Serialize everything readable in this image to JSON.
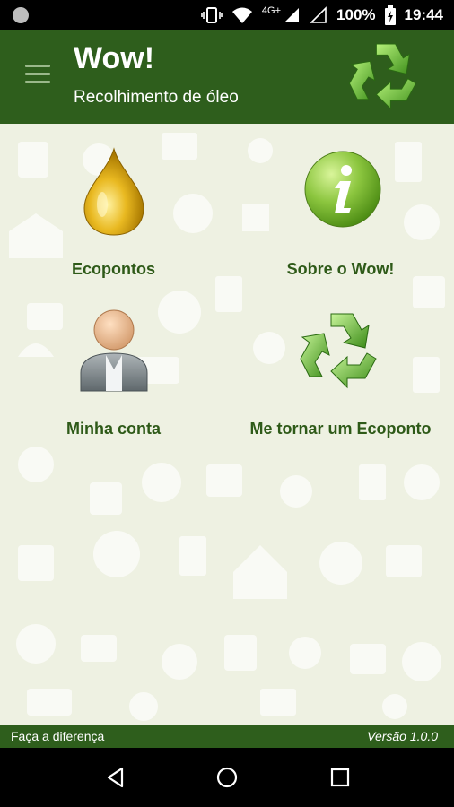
{
  "status_bar": {
    "network": "4G+",
    "battery": "100%",
    "time": "19:44"
  },
  "app_bar": {
    "title": "Wow!",
    "subtitle": "Recolhimento de óleo"
  },
  "menu": [
    {
      "label": "Ecopontos",
      "icon": "oil-drop-icon"
    },
    {
      "label": "Sobre o Wow!",
      "icon": "info-icon"
    },
    {
      "label": "Minha conta",
      "icon": "user-icon"
    },
    {
      "label": "Me tornar um Ecoponto",
      "icon": "recycle-icon"
    }
  ],
  "footer": {
    "left": "Faça a diferença",
    "right": "Versão 1.0.0"
  },
  "colors": {
    "primary": "#2e5e1c",
    "background": "#eef1e2",
    "label": "#2e5a18"
  }
}
